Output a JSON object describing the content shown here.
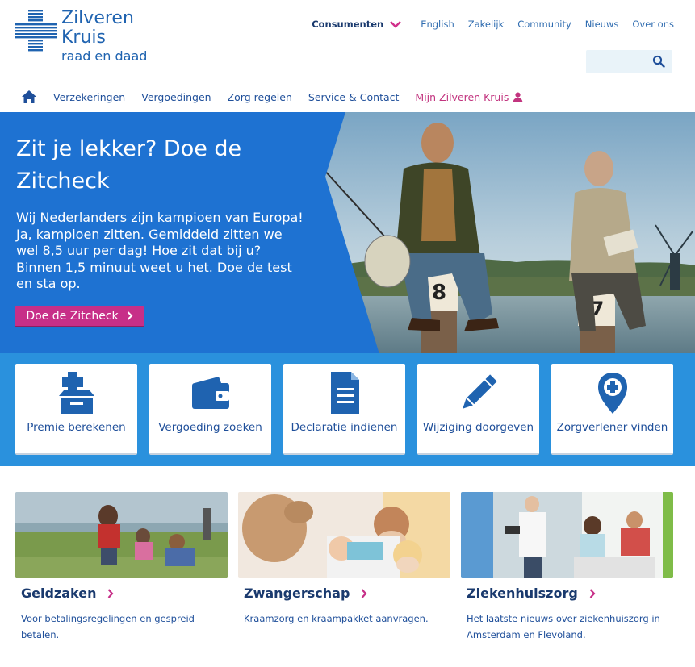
{
  "brand": {
    "line1": "Zilveren",
    "line2": "Kruis",
    "line3": "raad en daad",
    "color": "#1f63b0"
  },
  "topnav": {
    "active": "Consumenten",
    "links": [
      "English",
      "Zakelijk",
      "Community",
      "Nieuws",
      "Over ons"
    ]
  },
  "search": {
    "placeholder": "",
    "icon": "search-icon"
  },
  "mainnav": {
    "home_icon": "home-icon",
    "items": [
      "Verzekeringen",
      "Vergoedingen",
      "Zorg regelen",
      "Service & Contact"
    ],
    "account": "Mijn Zilveren Kruis"
  },
  "hero": {
    "title": "Zit je lekker? Doe de Zitcheck",
    "text": "Wij Nederlanders zijn kampioen van Europa! Ja, kampioen zitten. Gemiddeld zitten we wel 8,5 uur per dag! Hoe zit dat bij u? Binnen 1,5 minuut weet u het. Doe de test en sta op.",
    "button": "Doe de Zitcheck",
    "post_left": "8",
    "post_right": "7",
    "accent": "#c72f88",
    "blue": "#1e72d2"
  },
  "tiles": [
    {
      "label": "Premie berekenen",
      "icon": "medical-box-icon"
    },
    {
      "label": "Vergoeding zoeken",
      "icon": "wallet-icon"
    },
    {
      "label": "Declaratie indienen",
      "icon": "document-icon"
    },
    {
      "label": "Wijziging doorgeven",
      "icon": "pencil-icon"
    },
    {
      "label": "Zorgverlener vinden",
      "icon": "location-pin-icon"
    }
  ],
  "cards": [
    {
      "title": "Geldzaken",
      "desc": "Voor betalingsregelingen en gespreid betalen."
    },
    {
      "title": "Zwangerschap",
      "desc": "Kraamzorg en kraampakket aanvragen."
    },
    {
      "title": "Ziekenhuiszorg",
      "desc": "Het laatste nieuws over ziekenhuiszorg in Amsterdam en Flevoland."
    }
  ]
}
